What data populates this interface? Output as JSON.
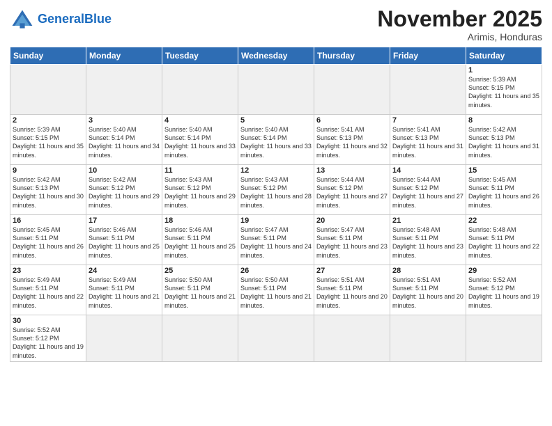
{
  "header": {
    "logo_general": "General",
    "logo_blue": "Blue",
    "month_title": "November 2025",
    "subtitle": "Arimis, Honduras"
  },
  "weekdays": [
    "Sunday",
    "Monday",
    "Tuesday",
    "Wednesday",
    "Thursday",
    "Friday",
    "Saturday"
  ],
  "weeks": [
    [
      {
        "day": "",
        "info": ""
      },
      {
        "day": "",
        "info": ""
      },
      {
        "day": "",
        "info": ""
      },
      {
        "day": "",
        "info": ""
      },
      {
        "day": "",
        "info": ""
      },
      {
        "day": "",
        "info": ""
      },
      {
        "day": "1",
        "info": "Sunrise: 5:39 AM\nSunset: 5:15 PM\nDaylight: 11 hours and 35 minutes."
      }
    ],
    [
      {
        "day": "2",
        "info": "Sunrise: 5:39 AM\nSunset: 5:15 PM\nDaylight: 11 hours and 35 minutes."
      },
      {
        "day": "3",
        "info": "Sunrise: 5:40 AM\nSunset: 5:14 PM\nDaylight: 11 hours and 34 minutes."
      },
      {
        "day": "4",
        "info": "Sunrise: 5:40 AM\nSunset: 5:14 PM\nDaylight: 11 hours and 33 minutes."
      },
      {
        "day": "5",
        "info": "Sunrise: 5:40 AM\nSunset: 5:14 PM\nDaylight: 11 hours and 33 minutes."
      },
      {
        "day": "6",
        "info": "Sunrise: 5:41 AM\nSunset: 5:13 PM\nDaylight: 11 hours and 32 minutes."
      },
      {
        "day": "7",
        "info": "Sunrise: 5:41 AM\nSunset: 5:13 PM\nDaylight: 11 hours and 31 minutes."
      },
      {
        "day": "8",
        "info": "Sunrise: 5:42 AM\nSunset: 5:13 PM\nDaylight: 11 hours and 31 minutes."
      }
    ],
    [
      {
        "day": "9",
        "info": "Sunrise: 5:42 AM\nSunset: 5:13 PM\nDaylight: 11 hours and 30 minutes."
      },
      {
        "day": "10",
        "info": "Sunrise: 5:42 AM\nSunset: 5:12 PM\nDaylight: 11 hours and 29 minutes."
      },
      {
        "day": "11",
        "info": "Sunrise: 5:43 AM\nSunset: 5:12 PM\nDaylight: 11 hours and 29 minutes."
      },
      {
        "day": "12",
        "info": "Sunrise: 5:43 AM\nSunset: 5:12 PM\nDaylight: 11 hours and 28 minutes."
      },
      {
        "day": "13",
        "info": "Sunrise: 5:44 AM\nSunset: 5:12 PM\nDaylight: 11 hours and 27 minutes."
      },
      {
        "day": "14",
        "info": "Sunrise: 5:44 AM\nSunset: 5:12 PM\nDaylight: 11 hours and 27 minutes."
      },
      {
        "day": "15",
        "info": "Sunrise: 5:45 AM\nSunset: 5:11 PM\nDaylight: 11 hours and 26 minutes."
      }
    ],
    [
      {
        "day": "16",
        "info": "Sunrise: 5:45 AM\nSunset: 5:11 PM\nDaylight: 11 hours and 26 minutes."
      },
      {
        "day": "17",
        "info": "Sunrise: 5:46 AM\nSunset: 5:11 PM\nDaylight: 11 hours and 25 minutes."
      },
      {
        "day": "18",
        "info": "Sunrise: 5:46 AM\nSunset: 5:11 PM\nDaylight: 11 hours and 25 minutes."
      },
      {
        "day": "19",
        "info": "Sunrise: 5:47 AM\nSunset: 5:11 PM\nDaylight: 11 hours and 24 minutes."
      },
      {
        "day": "20",
        "info": "Sunrise: 5:47 AM\nSunset: 5:11 PM\nDaylight: 11 hours and 23 minutes."
      },
      {
        "day": "21",
        "info": "Sunrise: 5:48 AM\nSunset: 5:11 PM\nDaylight: 11 hours and 23 minutes."
      },
      {
        "day": "22",
        "info": "Sunrise: 5:48 AM\nSunset: 5:11 PM\nDaylight: 11 hours and 22 minutes."
      }
    ],
    [
      {
        "day": "23",
        "info": "Sunrise: 5:49 AM\nSunset: 5:11 PM\nDaylight: 11 hours and 22 minutes."
      },
      {
        "day": "24",
        "info": "Sunrise: 5:49 AM\nSunset: 5:11 PM\nDaylight: 11 hours and 21 minutes."
      },
      {
        "day": "25",
        "info": "Sunrise: 5:50 AM\nSunset: 5:11 PM\nDaylight: 11 hours and 21 minutes."
      },
      {
        "day": "26",
        "info": "Sunrise: 5:50 AM\nSunset: 5:11 PM\nDaylight: 11 hours and 21 minutes."
      },
      {
        "day": "27",
        "info": "Sunrise: 5:51 AM\nSunset: 5:11 PM\nDaylight: 11 hours and 20 minutes."
      },
      {
        "day": "28",
        "info": "Sunrise: 5:51 AM\nSunset: 5:11 PM\nDaylight: 11 hours and 20 minutes."
      },
      {
        "day": "29",
        "info": "Sunrise: 5:52 AM\nSunset: 5:12 PM\nDaylight: 11 hours and 19 minutes."
      }
    ],
    [
      {
        "day": "30",
        "info": "Sunrise: 5:52 AM\nSunset: 5:12 PM\nDaylight: 11 hours and 19 minutes."
      },
      {
        "day": "",
        "info": ""
      },
      {
        "day": "",
        "info": ""
      },
      {
        "day": "",
        "info": ""
      },
      {
        "day": "",
        "info": ""
      },
      {
        "day": "",
        "info": ""
      },
      {
        "day": "",
        "info": ""
      }
    ]
  ]
}
